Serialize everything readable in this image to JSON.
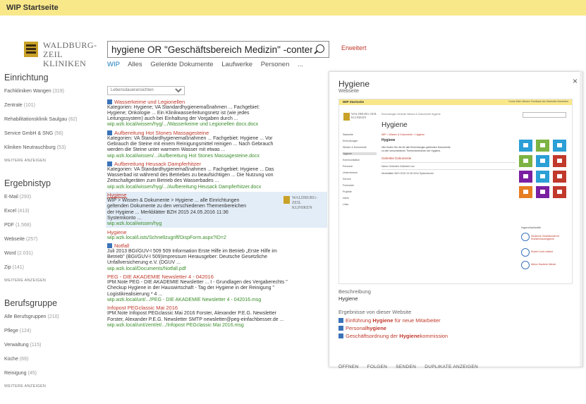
{
  "header": {
    "title": "WIP Startseite"
  },
  "logo": {
    "line1": "WALDBURG-ZEIL",
    "line2": "KLINIKEN"
  },
  "search": {
    "value": "hygiene OR \"Geschäftsbereich Medizin\" -contentclass",
    "advanced_label": "Erweitert",
    "tabs": [
      "WIP",
      "Alles",
      "Gelenkte Dokumente",
      "Laufwerke",
      "Personen",
      "..."
    ]
  },
  "refiners": {
    "einrichtung": {
      "title": "Einrichtung",
      "items": [
        {
          "label": "Fachkliniken Wangen",
          "count": "(319)"
        },
        {
          "label": "Zentrale",
          "count": "(101)"
        },
        {
          "label": "Rehabilitationsklinik Saulgau",
          "count": "(62)"
        },
        {
          "label": "Service GmbH & SNG",
          "count": "(56)"
        },
        {
          "label": "Kliniken Neutrauchburg",
          "count": "(53)"
        }
      ],
      "more": "WEITERE ANZEIGEN"
    },
    "ergebnistyp": {
      "title": "Ergebnistyp",
      "items": [
        {
          "label": "E-Mail",
          "count": "(293)"
        },
        {
          "label": "Excel",
          "count": "(413)"
        },
        {
          "label": "PDF",
          "count": "(1.568)"
        },
        {
          "label": "Webseite",
          "count": "(257)"
        },
        {
          "label": "Word",
          "count": "(2.031)"
        },
        {
          "label": "Zip",
          "count": "(141)"
        }
      ],
      "more": "WEITERE ANZEIGEN"
    },
    "berufsgruppe": {
      "title": "Berufsgruppe",
      "items": [
        {
          "label": "Alle Berufsgruppen",
          "count": "(210)"
        },
        {
          "label": "Pflege",
          "count": "(124)"
        },
        {
          "label": "Verwaltung",
          "count": "(115)"
        },
        {
          "label": "Küche",
          "count": "(69)"
        },
        {
          "label": "Reinigung",
          "count": "(45)"
        }
      ],
      "more": "WEITERE ANZEIGEN"
    }
  },
  "sort": {
    "selected": "Lebensdaueransichten"
  },
  "results": [
    {
      "title": "Wasserkeime und Legionellen",
      "snippet": [
        "Kategorien: Hygiene; VA Standardhygienemaßnahmen ... Fachgebiet:",
        "Hygiene; Onkologie ... Ein Klinikwasserleitungsnetz ist (wie jedes",
        "Leitungssystem) auch bei Einhaltung der Vorgaben durch ..."
      ],
      "url": "wip.wzk.local/wissen/hyg/.../Wasserkeime und Legionellen docx.docx"
    },
    {
      "title": "Aufbereitung Hot Stones Massagesteine",
      "snippet": [
        "Kategorien: VA Standardhygienemaßnahmen ... Fachgebiet: Hygiene ... Vor",
        "Gebrauch die Steine mit einem Reinigungsmittel reinigen ... Nach Gebrauch",
        "werden die Steine unter warmem Wasser mit etwas ..."
      ],
      "url": "wip.wzk.local/wissen/.../Aufbereitung Hot Stones Massagesteine.docx"
    },
    {
      "title": "Aufbereitung Heusack Dampferhitzer",
      "snippet": [
        "Kategorien: VA Standardhygienemaßnahmen ... Fachgebiet: Hygiene ... Das",
        "Wasserbad ist während des Betriebes zu beaufsichtigen ... Die Nutzung von",
        "Zeitschaltgeräten zum Betrieb des Wasserbades ..."
      ],
      "url": "wip.wzk.local/wissen/hyg/.../Aufbereitung Heusack Dampferhitzer.docx"
    },
    {
      "title": "Hygiene",
      "snippet": [
        "WIP > Wissen & Dokumente > Hygiene ... alle Einrichtungen",
        "geltenden Dokumente zu den verschiedenen Themenbereichen",
        "der Hygiene ... Merkblätter BZH 2015   24.05.2016 11:36",
        "Systemkonto ..."
      ],
      "url": "wip.wzk.local/wissen/hyg"
    },
    {
      "title": "Hygiene",
      "snippet": [],
      "url": "wip.wzk.local/Lists/Schnellzugriff/DispForm.aspx?ID=2"
    },
    {
      "title": "Notfall",
      "snippet": [
        "Juli 2013 BGI/GUV-I 509 509 Information Erste Hilfe im Betrieb „Erste Hilfe im",
        "Betrieb\" (BGI/GUV-I 509)Impressum Herausgeber: Deutsche Gesetzliche",
        "Unfallversicherung e.V. (DGUV ..."
      ],
      "url": "wip.wzk.local/Documents/Notfall.pdf"
    },
    {
      "title": "PEG - DIE AKADEMIE Newsletter 4 - 042016",
      "snippet": [
        "IPM.Note PEG - DIE AKADEMIE Newsletter ... I - Grundlagen des Vergaberechts \"",
        "Checkup Hygiene in der Hauswirtschaft - Tag der Hygiene in der Reinigung \"",
        "Logistikrealisierung * 4 ..."
      ],
      "url": "wip.wzk.local/unt/.../PEG - DIE AKADEMIE Newsletter 4 - 042016.msg"
    },
    {
      "title": "Infopost PEGclassic Mai 2016",
      "snippet": [
        "IPM.Note Infopost PEGclassic Mai 2016 Forster, Alexander P.E.G. Newsletter",
        "Forster, Alexander P.E.G. Newsletter SMTP newsletter@peg-einfachbesser.de ..."
      ],
      "url": "wip.wzk.local/unt/zent/et/.../Infopost PEGclassic Mai 2016.msg"
    }
  ],
  "preview": {
    "title": "Hygiene",
    "subtitle": "Webseite",
    "close": "×",
    "mini": {
      "topbar_title": "WIP Startseite",
      "topbar_right": "Home   Mein Wissen   Feedback   Als Startseite   Abmelden",
      "logo1": "WALDBURG-ZEIL",
      "logo2": "KLINIKEN",
      "breadcrumb": "Einrichtungen   Zentrale   Wissen & Dokumente   Hygiene",
      "heading": "Hygiene",
      "side_items": [
        "Startseite",
        "Einrichtungen",
        "Wissen & Dokumente",
        "Hygiene",
        "Kommunikation",
        "Personal",
        "Unternehmen",
        "Service",
        "Formulare",
        "Projekte",
        "Intern",
        "Links"
      ],
      "body_crumb": "WIP > Wissen & Dokumente > Hygiene",
      "body_title": "Hygiene",
      "body_text": [
        "Hier finden Sie die für alle Einrichtungen geltenden Dokumente",
        "zu den verschiedenen Themenbereichen der Hygiene."
      ],
      "docs_title": "Gelenkte Dokumente",
      "doc_rows": [
        "Name                       Geändert       Geändert von",
        "Merkblätter BZH 2015     24.05.2016     Systemkonto"
      ],
      "tile_colors": [
        "#2b9fd6",
        "#7cb342",
        "#2b9fd6",
        "#7cb342",
        "#2b9fd6",
        "#c0392b",
        "#7b1fa2",
        "#2b9fd6",
        "#c0392b",
        "#e67e22",
        "#7b1fa2",
        "#c0392b"
      ],
      "foot_title": "Hygienefachkräfte",
      "foot_items": [
        "Deutsche Gesellschaft für Krankenhaushygiene",
        "Robert Koch-Institut",
        "Aktion Saubere Hände"
      ]
    },
    "desc_label": "Beschreibung",
    "desc_value": "Hygiene",
    "site_label": "Ergebnisse von dieser Website",
    "site_results": [
      {
        "pre": "Einführung ",
        "bold": "Hygiene",
        "post": " für neue Mitarbeiter"
      },
      {
        "pre": "Personal",
        "bold": "hygiene",
        "post": ""
      },
      {
        "pre": "Geschäftsordnung der ",
        "bold": "Hygiene",
        "post": "kommission"
      }
    ],
    "actions": [
      "ÖFFNEN",
      "FOLGEN",
      "SENDEN",
      "DUPLIKATE ANZEIGEN"
    ]
  }
}
